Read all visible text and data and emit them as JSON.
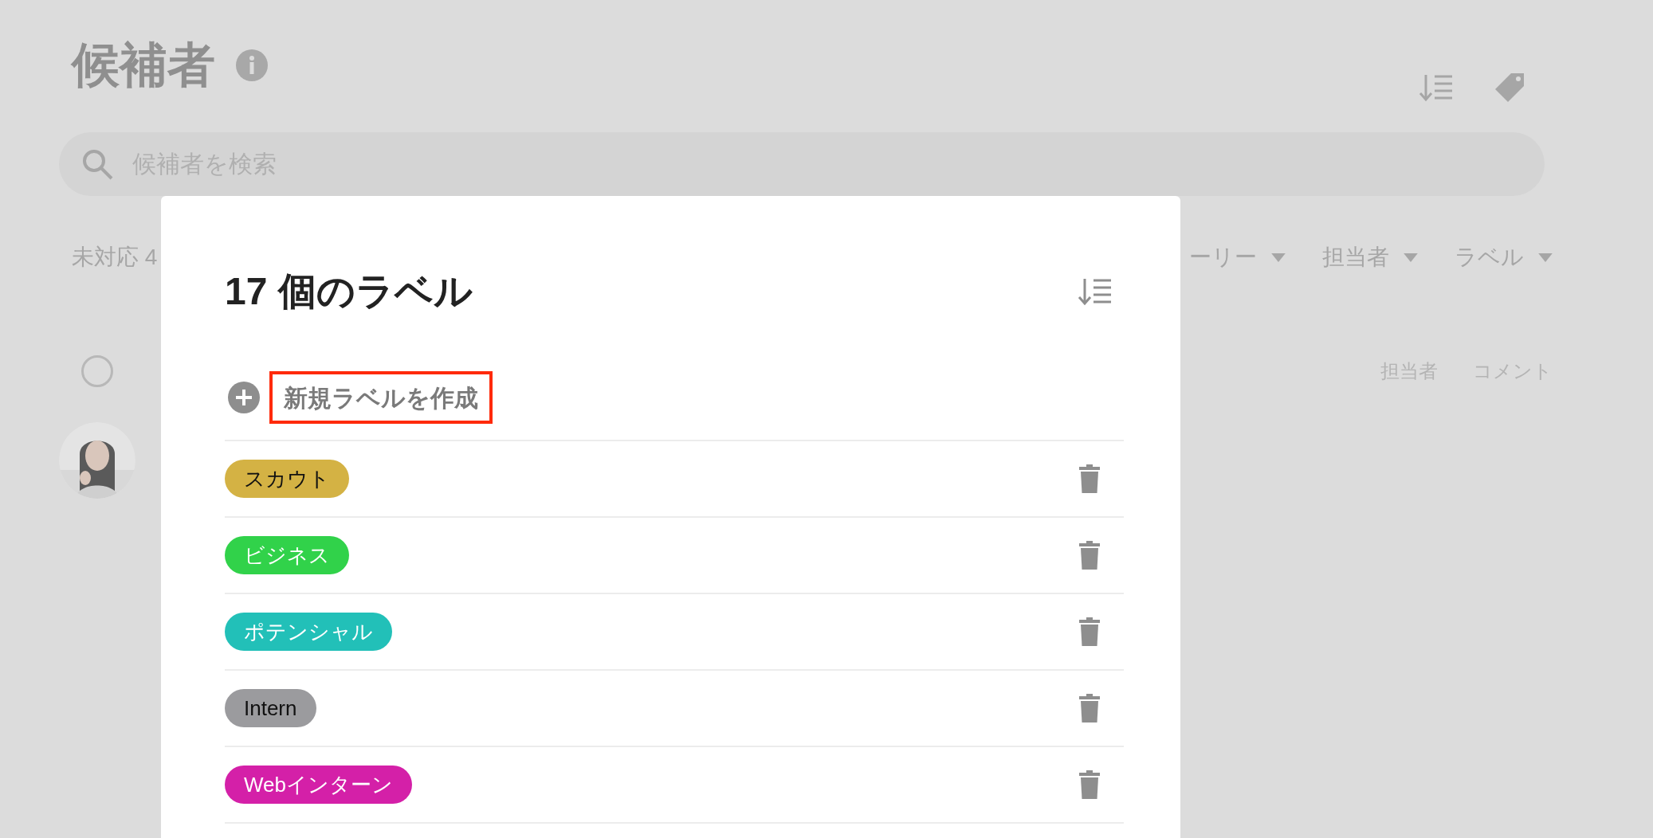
{
  "page": {
    "title": "候補者",
    "search": {
      "placeholder": "候補者を検索"
    },
    "filters": [
      {
        "label": "未対応 4",
        "kind": "count"
      },
      {
        "label": "ーリー",
        "kind": "dropdown"
      },
      {
        "label": "担当者",
        "kind": "dropdown"
      },
      {
        "label": "ラベル",
        "kind": "dropdown"
      }
    ],
    "columns": [
      "担当者",
      "コメント"
    ],
    "candidates": [
      {
        "checked": false
      }
    ]
  },
  "dialog": {
    "title": "17 個のラベル",
    "new_label": {
      "label": "新規ラベルを作成",
      "highlighted": true
    },
    "labels": [
      {
        "name": "スカウト",
        "color": "#d4b244",
        "dark_text": true
      },
      {
        "name": "ビジネス",
        "color": "#31d24a",
        "dark_text": false
      },
      {
        "name": "ポテンシャル",
        "color": "#22c0b8",
        "dark_text": false
      },
      {
        "name": "Intern",
        "color": "#9b9b9e",
        "dark_text": true
      },
      {
        "name": "Webインターン",
        "color": "#d420a8",
        "dark_text": false
      }
    ]
  }
}
